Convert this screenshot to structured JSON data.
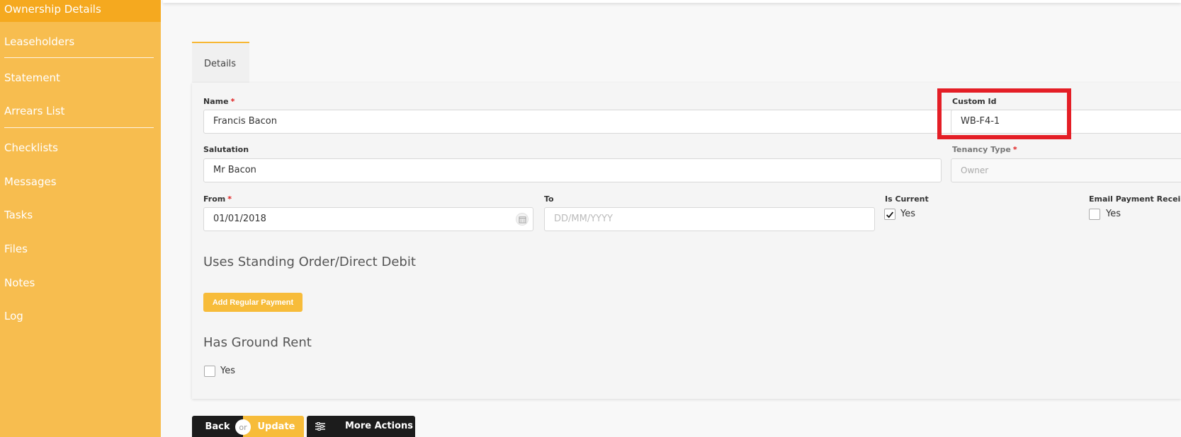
{
  "sidebar": {
    "items": [
      {
        "label": "Ownership Details"
      },
      {
        "label": "Leaseholders"
      },
      {
        "label": "Statement"
      },
      {
        "label": "Arrears List"
      },
      {
        "label": "Checklists"
      },
      {
        "label": "Messages"
      },
      {
        "label": "Tasks"
      },
      {
        "label": "Files"
      },
      {
        "label": "Notes"
      },
      {
        "label": "Log"
      }
    ]
  },
  "tabs": [
    {
      "label": "Details"
    }
  ],
  "form": {
    "name": {
      "label": "Name",
      "required": "*",
      "value": "Francis Bacon"
    },
    "custom_id": {
      "label": "Custom Id",
      "value": "WB-F4-1"
    },
    "salutation": {
      "label": "Salutation",
      "value": "Mr Bacon"
    },
    "tenancy_type": {
      "label": "Tenancy Type",
      "required": "*",
      "value": "Owner"
    },
    "from": {
      "label": "From",
      "required": "*",
      "value": "01/01/2018"
    },
    "to": {
      "label": "To",
      "placeholder": "DD/MM/YYYY"
    },
    "is_current": {
      "label": "Is Current",
      "option": "Yes",
      "checked": true
    },
    "email_payment_receipt": {
      "label": "Email Payment Receipt",
      "option": "Yes",
      "checked": false
    },
    "standing_order": {
      "title": "Uses Standing Order/Direct Debit",
      "button": "Add Regular Payment"
    },
    "ground_rent": {
      "title": "Has Ground Rent",
      "option": "Yes",
      "checked": false
    }
  },
  "actions": {
    "back": "Back",
    "or": "or",
    "update": "Update",
    "more": "More Actions"
  },
  "colors": {
    "sidebar": "#f7bd4f",
    "sidebar_active": "#f5a91f",
    "accent": "#f7bc3a",
    "highlight": "#e41e26"
  }
}
